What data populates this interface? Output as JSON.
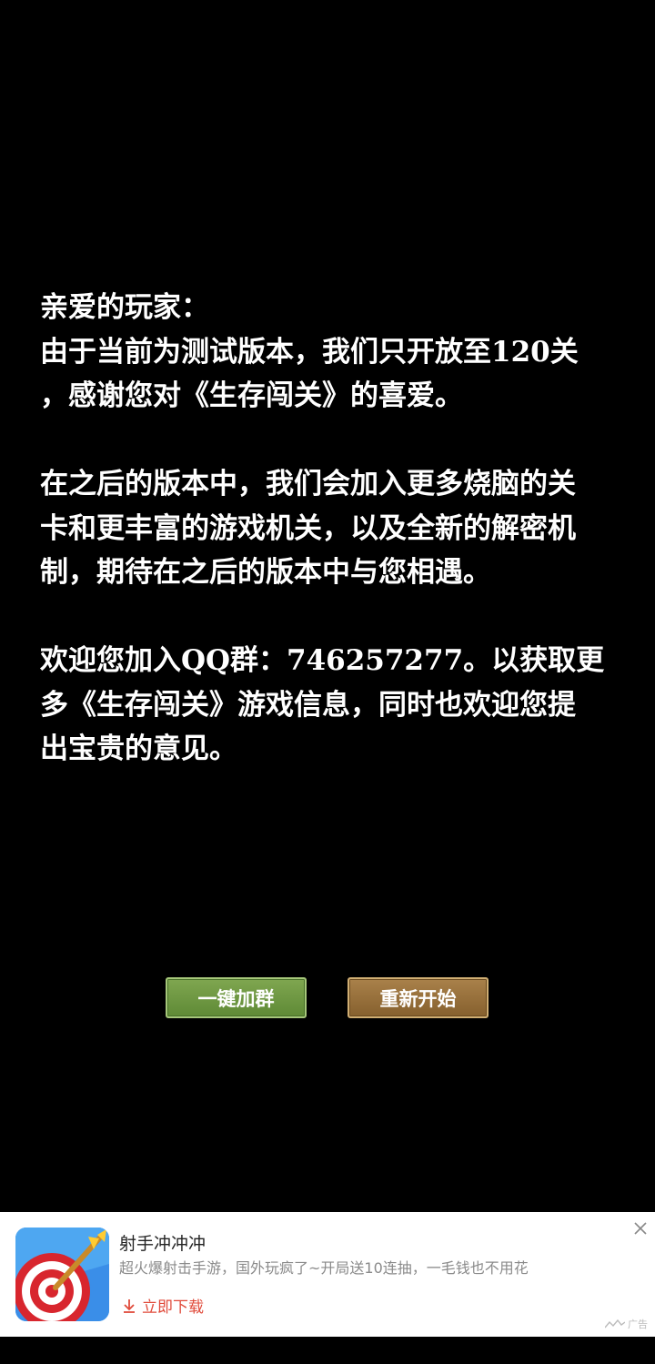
{
  "message": {
    "paragraph1": "亲爱的玩家：\n由于当前为测试版本，我们只开放至120关\n，感谢您对《生存闯关》的喜爱。",
    "paragraph2": "在之后的版本中，我们会加入更多烧脑的关\n卡和更丰富的游戏机关，以及全新的解密机\n制，期待在之后的版本中与您相遇。",
    "paragraph3": "欢迎您加入QQ群：746257277。以获取更\n多《生存闯关》游戏信息，同时也欢迎您提\n出宝贵的意见。"
  },
  "buttons": {
    "join_group": "一键加群",
    "restart": "重新开始"
  },
  "ad": {
    "title": "射手冲冲冲",
    "description": "超火爆射击手游，国外玩疯了~开局送10连抽，一毛钱也不用花",
    "download": "立即下载",
    "label": "广告",
    "icon": "archery-target-icon"
  },
  "colors": {
    "background": "#000000",
    "text": "#ffffff",
    "join_button": "#6b9640",
    "restart_button": "#97703c",
    "ad_download": "#e04a3a"
  }
}
